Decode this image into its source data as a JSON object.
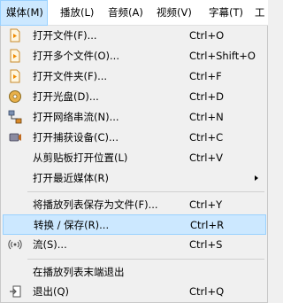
{
  "menubar": {
    "items": [
      {
        "label": "媒体(M)"
      },
      {
        "label": "播放(L)"
      },
      {
        "label": "音频(A)"
      },
      {
        "label": "视频(V)"
      },
      {
        "label": "字幕(T)"
      },
      {
        "label": "工"
      }
    ]
  },
  "menu": {
    "items": [
      {
        "label": "打开文件(F)...",
        "shortcut": "Ctrl+O"
      },
      {
        "label": "打开多个文件(O)...",
        "shortcut": "Ctrl+Shift+O"
      },
      {
        "label": "打开文件夹(F)...",
        "shortcut": "Ctrl+F"
      },
      {
        "label": "打开光盘(D)...",
        "shortcut": "Ctrl+D"
      },
      {
        "label": "打开网络串流(N)...",
        "shortcut": "Ctrl+N"
      },
      {
        "label": "打开捕获设备(C)...",
        "shortcut": "Ctrl+C"
      },
      {
        "label": "从剪贴板打开位置(L)",
        "shortcut": "Ctrl+V"
      },
      {
        "label": "打开最近媒体(R)",
        "shortcut": ""
      },
      {
        "label": "将播放列表保存为文件(F)...",
        "shortcut": "Ctrl+Y"
      },
      {
        "label": "转换 / 保存(R)...",
        "shortcut": "Ctrl+R"
      },
      {
        "label": "流(S)...",
        "shortcut": "Ctrl+S"
      },
      {
        "label": "在播放列表末端退出",
        "shortcut": ""
      },
      {
        "label": "退出(Q)",
        "shortcut": "Ctrl+Q"
      }
    ]
  },
  "colors": {
    "highlight": "#cce8ff",
    "highlight_border": "#99d1ff",
    "menu_bg": "#f0f0f0"
  }
}
